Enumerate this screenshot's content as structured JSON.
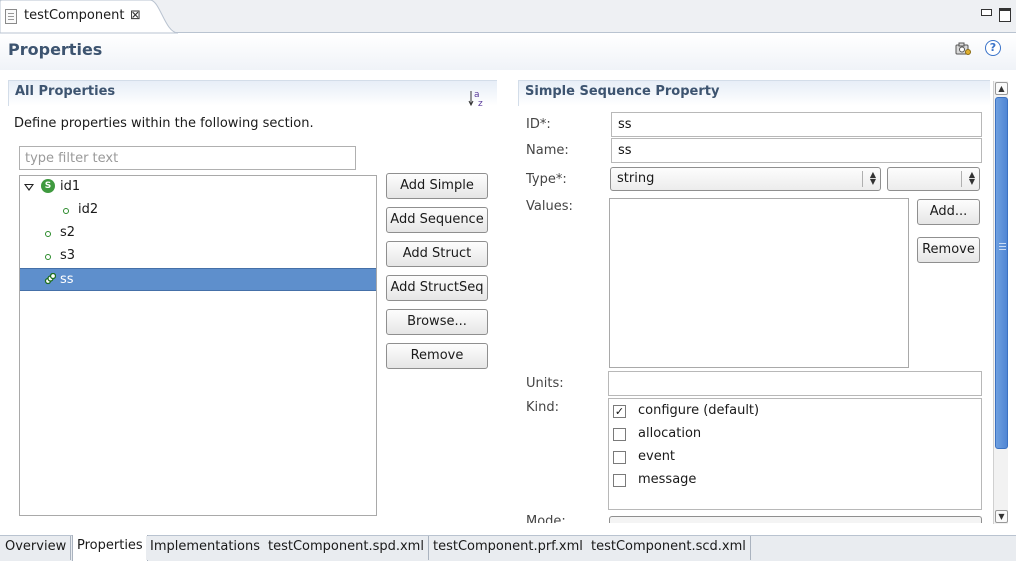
{
  "editor_tab": {
    "label": "testComponent",
    "close_glyph": "⊠"
  },
  "header": {
    "title": "Properties",
    "icons": [
      "camera-settings-icon",
      "help-icon"
    ],
    "help_glyph": "?"
  },
  "all_properties": {
    "title": "All Properties",
    "description": "Define properties within the following section.",
    "filter_placeholder": "type filter text",
    "sort_icon": "sort-alpha-icon",
    "tree": [
      {
        "label": "id1",
        "kind": "struct",
        "icon_letter": "S",
        "expanded": true,
        "depth": 0
      },
      {
        "label": "id2",
        "kind": "simple",
        "depth": 1
      },
      {
        "label": "s2",
        "kind": "simple",
        "depth": 0
      },
      {
        "label": "s3",
        "kind": "simple",
        "depth": 0
      },
      {
        "label": "ss",
        "kind": "simple-sequence",
        "depth": 0,
        "selected": true
      }
    ],
    "buttons": [
      "Add Simple",
      "Add Sequence",
      "Add Struct",
      "Add StructSeq",
      "Browse...",
      "Remove"
    ]
  },
  "detail": {
    "title": "Simple Sequence Property",
    "id_label": "ID*:",
    "id_value": "ss",
    "name_label": "Name:",
    "name_value": "ss",
    "type_label": "Type*:",
    "type_value": "string",
    "type_modifier_value": "",
    "values_label": "Values:",
    "values": [],
    "add_button": "Add...",
    "remove_button": "Remove",
    "units_label": "Units:",
    "units_value": "",
    "kind_label": "Kind:",
    "kinds": [
      {
        "label": "configure (default)",
        "checked": true
      },
      {
        "label": "allocation",
        "checked": false
      },
      {
        "label": "event",
        "checked": false
      },
      {
        "label": "message",
        "checked": false
      }
    ],
    "mode_label": "Mode:"
  },
  "bottom_tabs": [
    {
      "label": "Overview",
      "active": false
    },
    {
      "label": "Properties",
      "active": true
    },
    {
      "label": "Implementations",
      "active": false
    },
    {
      "label": "testComponent.spd.xml",
      "active": false
    },
    {
      "label": "testComponent.prf.xml",
      "active": false
    },
    {
      "label": "testComponent.scd.xml",
      "active": false
    }
  ],
  "colors": {
    "selection": "#5e8fcc",
    "section_title": "#3d5470",
    "struct_icon": "#3f9a3f"
  }
}
